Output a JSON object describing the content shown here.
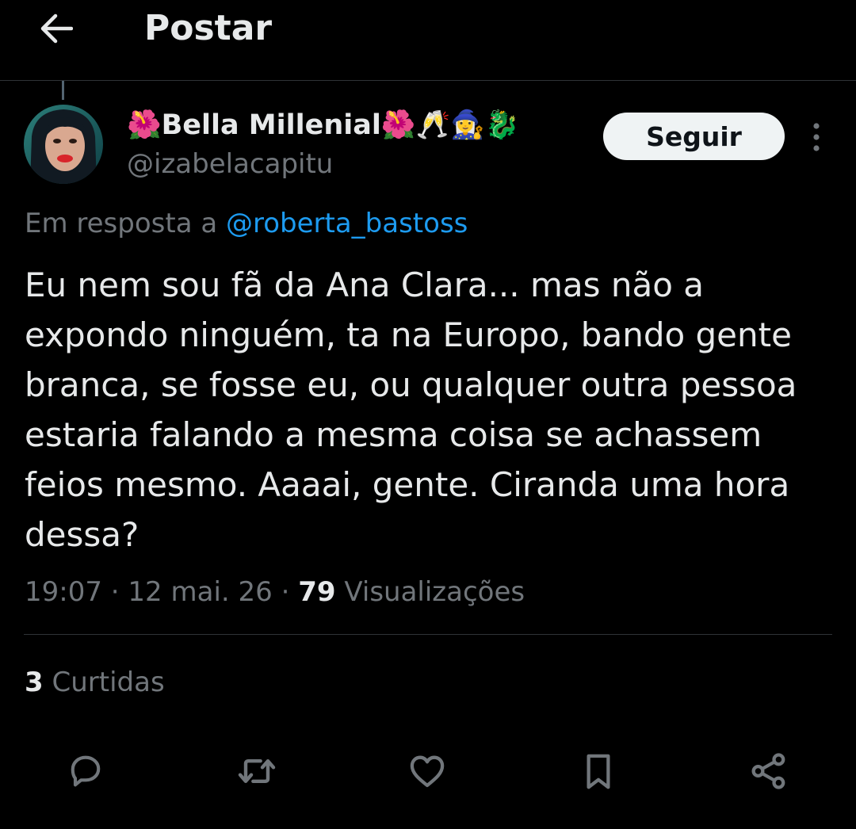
{
  "header": {
    "back_icon": "arrow-left-icon",
    "title": "Postar"
  },
  "author": {
    "display_name": "🌺Bella Millenial🌺🥂🧙‍♀️🐉",
    "handle": "@izabelacapitu",
    "follow_label": "Seguir",
    "more_icon": "more-vertical-icon"
  },
  "reply": {
    "prefix": "Em resposta a ",
    "username": "@roberta_bastoss"
  },
  "post": {
    "text": "Eu nem sou fã da Ana Clara... mas não a\nexpondo ninguém, ta na Europo, bando gente\nbranca, se fosse eu, ou qualquer outra pessoa\nestaria falando a mesma coisa se achassem\nfeios mesmo. Aaaai, gente. Ciranda uma hora\ndessa?",
    "time": "19:07",
    "date": "12 mai. 26",
    "views_count": "79",
    "views_label": " Visualizações",
    "separator": " · "
  },
  "stats": {
    "likes_count": "3",
    "likes_label": " Curtidas"
  },
  "actions": [
    {
      "name": "reply",
      "icon": "reply-bubble-icon"
    },
    {
      "name": "repost",
      "icon": "repost-icon"
    },
    {
      "name": "like",
      "icon": "heart-icon"
    },
    {
      "name": "bookmark",
      "icon": "bookmark-icon"
    },
    {
      "name": "share",
      "icon": "share-icon"
    }
  ],
  "colors": {
    "background": "#000000",
    "text_primary": "#e7e9ea",
    "text_secondary": "#71767b",
    "link": "#1d9bf0",
    "divider": "#2f3336",
    "follow_button_bg": "#eff3f4"
  }
}
